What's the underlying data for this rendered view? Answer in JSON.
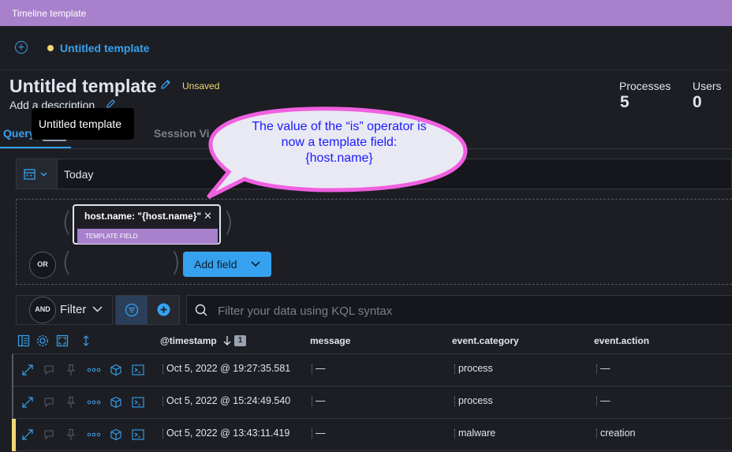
{
  "window": {
    "title": "Timeline template"
  },
  "nav": {
    "title": "Untitled template"
  },
  "header": {
    "title": "Untitled template",
    "status": "Unsaved",
    "description_placeholder": "Add a description",
    "tooltip": "Untitled template"
  },
  "stats": [
    {
      "label": "Processes",
      "value": "5"
    },
    {
      "label": "Users",
      "value": "0"
    }
  ],
  "tabs": [
    {
      "label": "Query",
      "active": true
    },
    {
      "label": "Session Vi",
      "active": false
    }
  ],
  "date_picker": {
    "value": "Today"
  },
  "query_builder": {
    "pill_text": "host.name: \"{host.name}\"",
    "pill_tag": "TEMPLATE FIELD",
    "or_label": "OR",
    "add_field_label": "Add field"
  },
  "filter_bar": {
    "and_label": "AND",
    "filter_label": "Filter",
    "search_placeholder": "Filter your data using KQL syntax"
  },
  "table": {
    "columns": [
      "@timestamp",
      "message",
      "event.category",
      "event.action"
    ],
    "sort_number": "1",
    "rows": [
      {
        "timestamp": "Oct 5, 2022 @ 19:27:35.581",
        "message": "—",
        "category": "process",
        "action": "—"
      },
      {
        "timestamp": "Oct 5, 2022 @ 15:24:49.540",
        "message": "—",
        "category": "process",
        "action": "—"
      },
      {
        "timestamp": "Oct 5, 2022 @ 13:43:11.419",
        "message": "—",
        "category": "malware",
        "action": "creation"
      }
    ]
  },
  "callout": {
    "line1": "The value of the “is” operator is",
    "line2": "now a template field:",
    "line3": "{host.name}"
  },
  "colors": {
    "accent": "#36a2ef",
    "template_purple": "#a880cc",
    "unsaved_yellow": "#f1d86f",
    "callout_border": "#f060e0",
    "callout_text": "#1a1aff"
  }
}
